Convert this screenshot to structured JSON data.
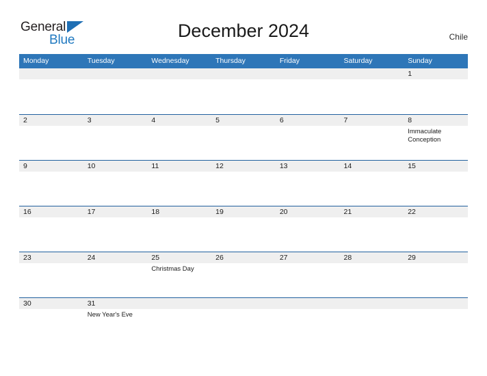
{
  "brand": {
    "word1": "General",
    "word2": "Blue",
    "triangle_icon": "triangle-icon",
    "colors": {
      "general": "#231f20",
      "blue": "#2079c0",
      "triangle": "#1f6fb4"
    }
  },
  "header": {
    "title": "December 2024",
    "locale": "Chile"
  },
  "theme": {
    "header_bg": "#2e76b8",
    "header_text": "#ffffff",
    "row_rule": "#1f5f9e",
    "daynum_band": "#efefef",
    "page_bg": "#ffffff",
    "text": "#1a1a1a"
  },
  "calendar": {
    "month": "December",
    "year": "2024",
    "weekday_headers": [
      "Monday",
      "Tuesday",
      "Wednesday",
      "Thursday",
      "Friday",
      "Saturday",
      "Sunday"
    ],
    "weeks": [
      [
        {
          "day": "",
          "event": ""
        },
        {
          "day": "",
          "event": ""
        },
        {
          "day": "",
          "event": ""
        },
        {
          "day": "",
          "event": ""
        },
        {
          "day": "",
          "event": ""
        },
        {
          "day": "",
          "event": ""
        },
        {
          "day": "1",
          "event": ""
        }
      ],
      [
        {
          "day": "2",
          "event": ""
        },
        {
          "day": "3",
          "event": ""
        },
        {
          "day": "4",
          "event": ""
        },
        {
          "day": "5",
          "event": ""
        },
        {
          "day": "6",
          "event": ""
        },
        {
          "day": "7",
          "event": ""
        },
        {
          "day": "8",
          "event": "Immaculate Conception"
        }
      ],
      [
        {
          "day": "9",
          "event": ""
        },
        {
          "day": "10",
          "event": ""
        },
        {
          "day": "11",
          "event": ""
        },
        {
          "day": "12",
          "event": ""
        },
        {
          "day": "13",
          "event": ""
        },
        {
          "day": "14",
          "event": ""
        },
        {
          "day": "15",
          "event": ""
        }
      ],
      [
        {
          "day": "16",
          "event": ""
        },
        {
          "day": "17",
          "event": ""
        },
        {
          "day": "18",
          "event": ""
        },
        {
          "day": "19",
          "event": ""
        },
        {
          "day": "20",
          "event": ""
        },
        {
          "day": "21",
          "event": ""
        },
        {
          "day": "22",
          "event": ""
        }
      ],
      [
        {
          "day": "23",
          "event": ""
        },
        {
          "day": "24",
          "event": ""
        },
        {
          "day": "25",
          "event": "Christmas Day"
        },
        {
          "day": "26",
          "event": ""
        },
        {
          "day": "27",
          "event": ""
        },
        {
          "day": "28",
          "event": ""
        },
        {
          "day": "29",
          "event": ""
        }
      ],
      [
        {
          "day": "30",
          "event": ""
        },
        {
          "day": "31",
          "event": "New Year's Eve"
        },
        {
          "day": "",
          "event": ""
        },
        {
          "day": "",
          "event": ""
        },
        {
          "day": "",
          "event": ""
        },
        {
          "day": "",
          "event": ""
        },
        {
          "day": "",
          "event": ""
        }
      ]
    ]
  }
}
